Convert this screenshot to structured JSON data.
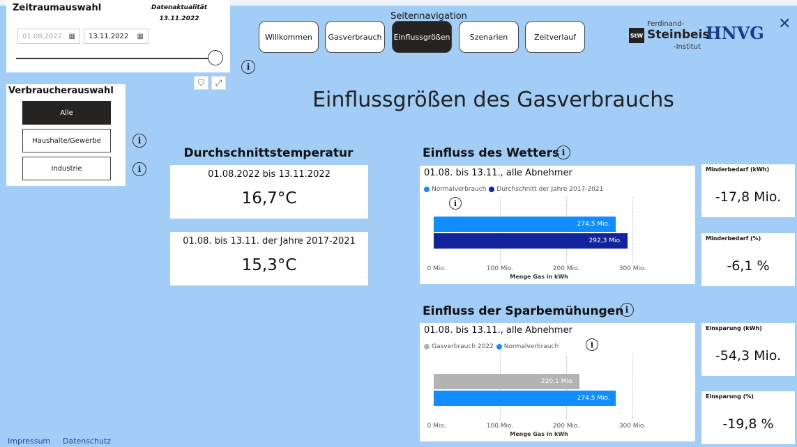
{
  "zeitraum": {
    "title": "Zeitraumauswahl",
    "aktualitaet_label": "Datenaktualität",
    "aktualitaet_date": "13.11.2022",
    "start_date": "01.08.2022",
    "end_date": "13.11.2022",
    "slider_value": 1.0
  },
  "verbraucher": {
    "title": "Verbraucherauswahl",
    "options": [
      "Alle",
      "Haushalte/Gewerbe",
      "Industrie"
    ],
    "selected": "Alle"
  },
  "nav": {
    "title": "Seitennavigation",
    "items": [
      "Willkommen",
      "Gasverbrauch",
      "Einflussgrößen",
      "Szenarien",
      "Zeitverlauf"
    ],
    "active": "Einflussgrößen"
  },
  "logos": {
    "fs_small": "Ferdinand-",
    "fs_name": "Steinbeis",
    "fs_inst": "-Institut",
    "fs_mark": "StW",
    "hnvg": "HNVG"
  },
  "page_title": "Einflussgrößen des Gasverbrauchs",
  "temperatur": {
    "heading": "Durchschnittstemperatur",
    "current_label": "01.08.2022 bis 13.11.2022",
    "current_value": "16,7°C",
    "hist_label": "01.08. bis 13.11. der Jahre 2017-2021",
    "hist_value": "15,3°C"
  },
  "wetter": {
    "heading": "Einfluss des Wetters",
    "subtitle": "01.08. bis 13.11., alle Abnehmer",
    "kpi_abs_label": "Minderbedarf (kWh)",
    "kpi_abs_value": "-17,8 Mio.",
    "kpi_pct_label": "Minderbedarf (%)",
    "kpi_pct_value": "-6,1 %"
  },
  "spar": {
    "heading": "Einfluss der Sparbemühungen",
    "subtitle": "01.08. bis 13.11., alle Abnehmer",
    "kpi_abs_label": "Einsparung (kWh)",
    "kpi_abs_value": "-54,3 Mio.",
    "kpi_pct_label": "Einsparung (%)",
    "kpi_pct_value": "-19,8 %"
  },
  "chart_data": [
    {
      "type": "bar",
      "orientation": "horizontal",
      "series": [
        {
          "name": "Normalverbrauch",
          "values": [
            274.5
          ],
          "label": "274,5 Mio.",
          "color": "#118dff"
        },
        {
          "name": "Durchschnitt der Jahre 2017-2021",
          "values": [
            292.3
          ],
          "label": "292,3 Mio.",
          "color": "#12239e"
        }
      ],
      "xlabel": "Menge Gas in kWh",
      "x_ticks": [
        "0 Mio.",
        "100 Mio.",
        "200 Mio.",
        "300 Mio."
      ],
      "xlim": [
        0,
        300
      ]
    },
    {
      "type": "bar",
      "orientation": "horizontal",
      "series": [
        {
          "name": "Gasverbrauch 2022",
          "values": [
            220.1
          ],
          "label": "220,1 Mio.",
          "color": "#b3b3b3"
        },
        {
          "name": "Normalverbrauch",
          "values": [
            274.5
          ],
          "label": "274,5 Mio.",
          "color": "#118dff"
        }
      ],
      "xlabel": "Menge Gas in kWh",
      "x_ticks": [
        "0 Mio.",
        "100 Mio.",
        "200 Mio.",
        "300 Mio."
      ],
      "xlim": [
        0,
        300
      ]
    }
  ],
  "footer": {
    "impressum": "Impressum",
    "datenschutz": "Datenschutz"
  }
}
